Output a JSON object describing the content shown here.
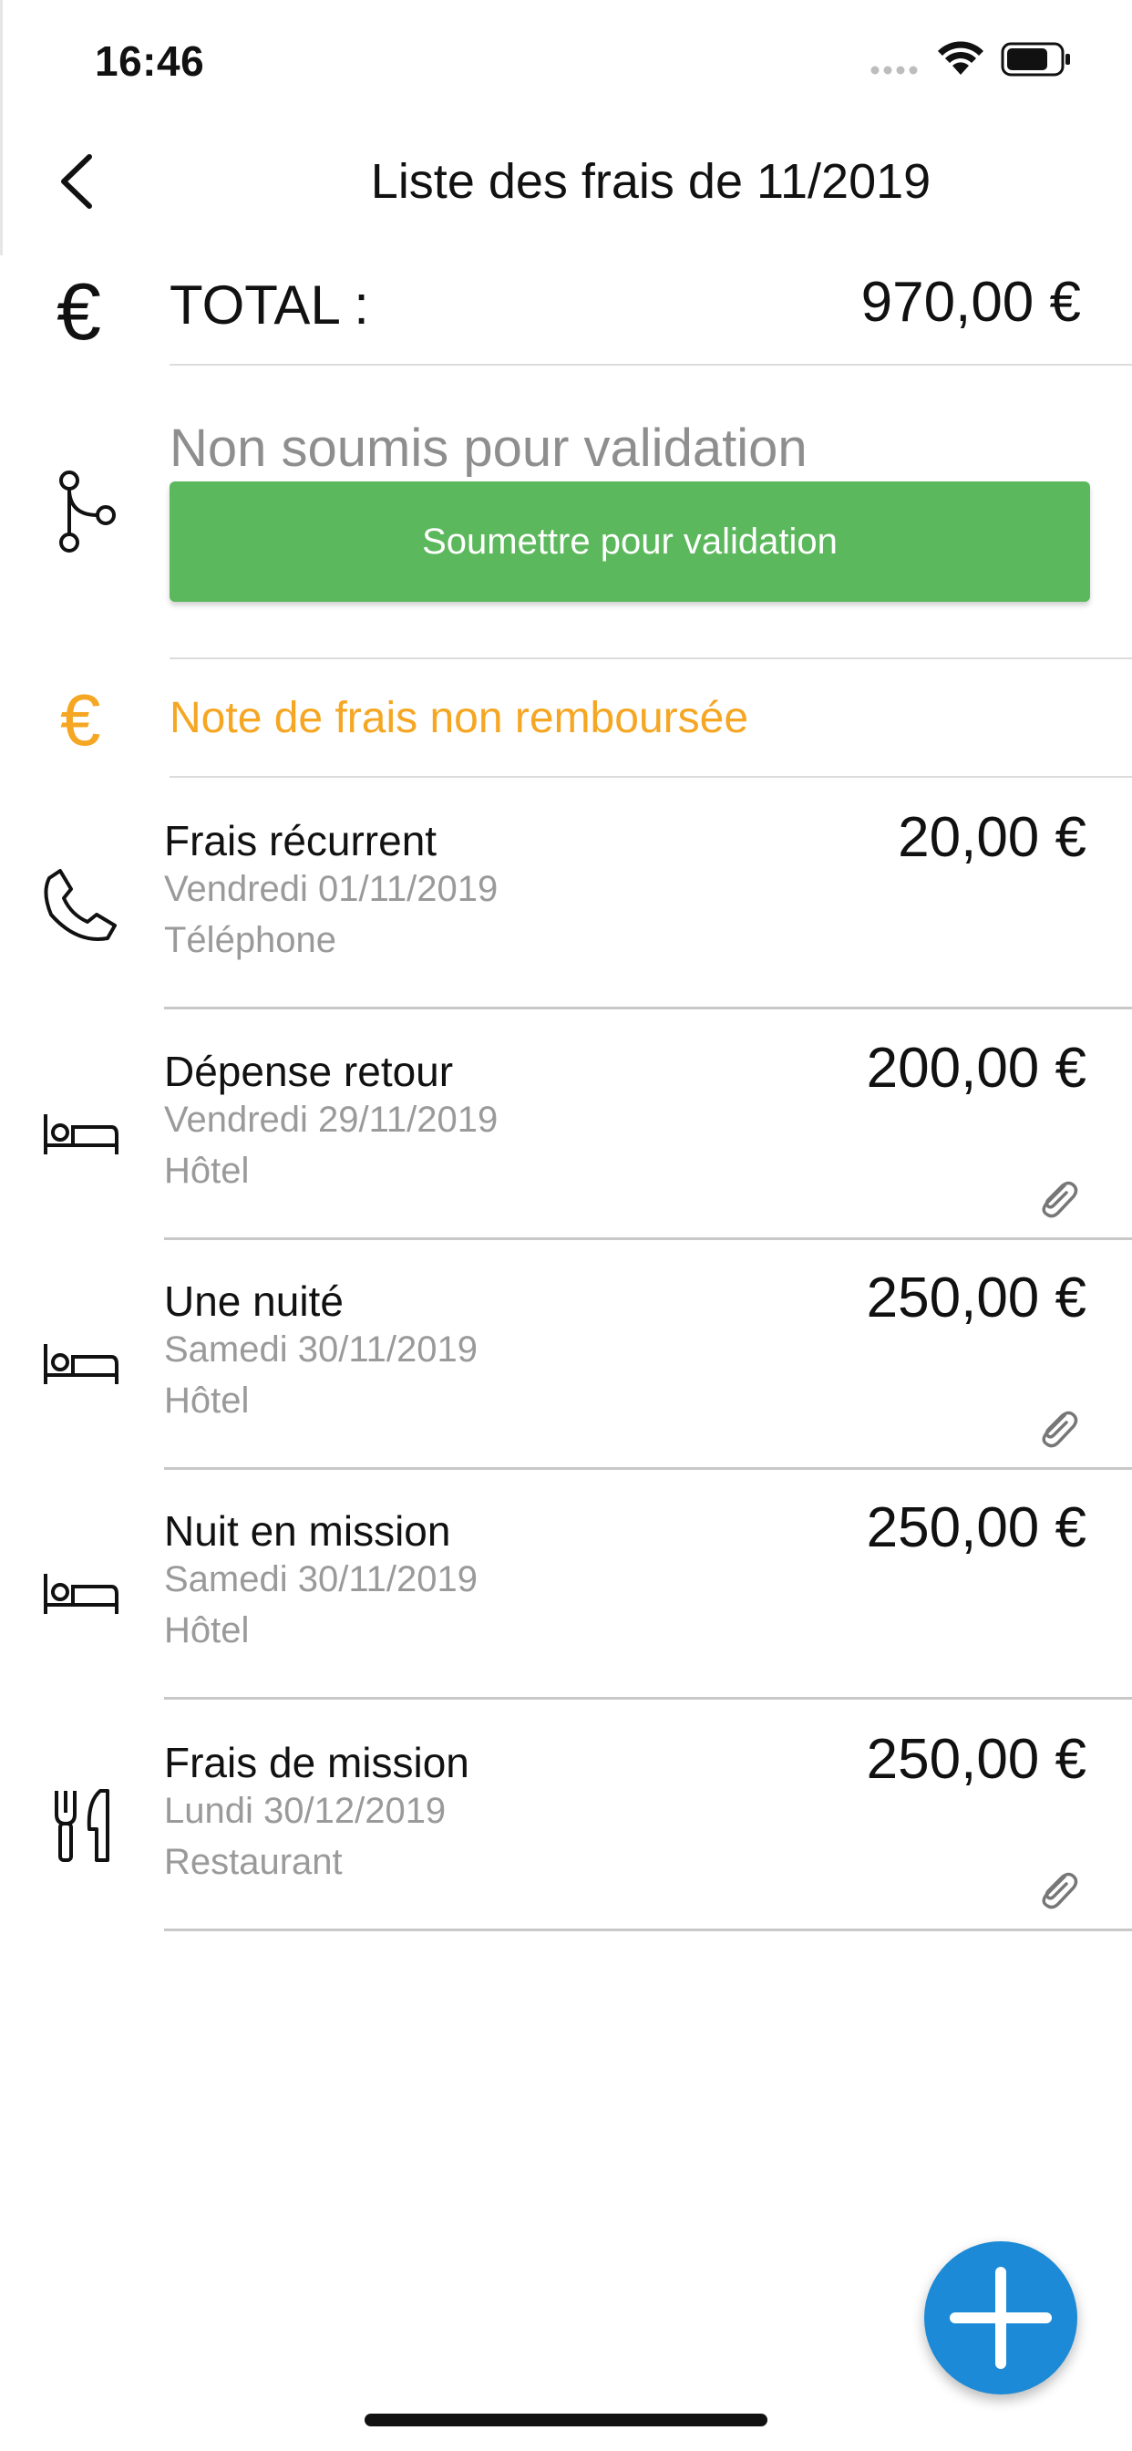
{
  "status_bar": {
    "time": "16:46"
  },
  "nav": {
    "title": "Liste des frais de 11/2019"
  },
  "total": {
    "label": "TOTAL :",
    "value": "970,00 €",
    "icon": "euro-icon"
  },
  "validation": {
    "status": "Non soumis pour validation",
    "button_label": "Soumettre pour validation",
    "button_color": "#5cb85c",
    "icon": "branch-icon"
  },
  "refund": {
    "label": "Note de frais non remboursée",
    "color": "#f5a623",
    "icon": "euro-icon"
  },
  "expenses": [
    {
      "name": "Frais récurrent",
      "date": "Vendredi 01/11/2019",
      "category": "Téléphone",
      "amount": "20,00 €",
      "icon": "phone-icon",
      "attachment": false
    },
    {
      "name": "Dépense retour",
      "date": "Vendredi 29/11/2019",
      "category": "Hôtel",
      "amount": "200,00 €",
      "icon": "bed-icon",
      "attachment": true
    },
    {
      "name": "Une nuité",
      "date": "Samedi 30/11/2019",
      "category": "Hôtel",
      "amount": "250,00 €",
      "icon": "bed-icon",
      "attachment": true
    },
    {
      "name": "Nuit en mission",
      "date": "Samedi 30/11/2019",
      "category": "Hôtel",
      "amount": "250,00 €",
      "icon": "bed-icon",
      "attachment": false
    },
    {
      "name": "Frais de mission",
      "date": "Lundi 30/12/2019",
      "category": "Restaurant",
      "amount": "250,00 €",
      "icon": "restaurant-icon",
      "attachment": true
    }
  ],
  "fab": {
    "icon": "plus-icon",
    "color": "#1c8ad6"
  }
}
